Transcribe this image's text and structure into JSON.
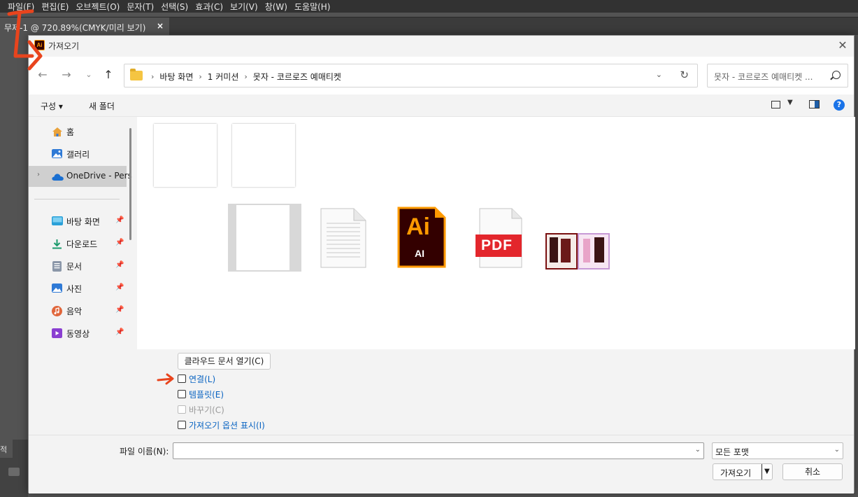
{
  "app": {
    "menu": [
      "파일(F)",
      "편집(E)",
      "오브젝트(O)",
      "문자(T)",
      "선택(S)",
      "효과(C)",
      "보기(V)",
      "창(W)",
      "도움말(H)"
    ],
    "doc_tab": "무제-1 @ 720.89%(CMYK/미리 보기)",
    "bottom_tab": "적"
  },
  "dialog": {
    "title": "가져오기",
    "breadcrumbs": [
      "바탕 화면",
      "1 커미션",
      "못자 - 코르로즈 예매티켓"
    ],
    "search_placeholder": "못자 - 코르로즈 예매티켓 ...",
    "toolbar": {
      "organize": "구성 ▾",
      "new_folder": "새 폴더"
    },
    "sidebar": {
      "top_items": [
        {
          "label": "홈",
          "icon": "home-icon"
        },
        {
          "label": "갤러리",
          "icon": "gallery-icon"
        },
        {
          "label": "OneDrive - Pers",
          "icon": "onedrive-icon"
        }
      ],
      "quick_items": [
        {
          "label": "바탕 화면",
          "icon": "desktop-icon"
        },
        {
          "label": "다운로드",
          "icon": "download-icon"
        },
        {
          "label": "문서",
          "icon": "document-icon"
        },
        {
          "label": "사진",
          "icon": "pictures-icon"
        },
        {
          "label": "음악",
          "icon": "music-icon"
        },
        {
          "label": "동영상",
          "icon": "video-icon"
        }
      ]
    },
    "file_icons": {
      "ai_big": "Ai",
      "ai_small": "AI",
      "pdf": "PDF"
    },
    "options": {
      "cloud_button": "클라우드 문서 열기(C)",
      "checkboxes": [
        {
          "label": "연결(L)",
          "checked": false,
          "disabled": false
        },
        {
          "label": "템플릿(E)",
          "checked": false,
          "disabled": false
        },
        {
          "label": "바꾸기(C)",
          "checked": false,
          "disabled": true
        },
        {
          "label": "가져오기 옵션 표시(I)",
          "checked": false,
          "disabled": false
        }
      ]
    },
    "bottom": {
      "filename_label": "파일 이름(N):",
      "filename_value": "",
      "filter": "모든 포맷",
      "import_button": "가져오기",
      "cancel_button": "취소"
    }
  },
  "colors": {
    "accent": "#0a64c2",
    "annotation": "#e8441d",
    "ai_orange": "#ff9a00",
    "pdf_red": "#e3262c"
  }
}
